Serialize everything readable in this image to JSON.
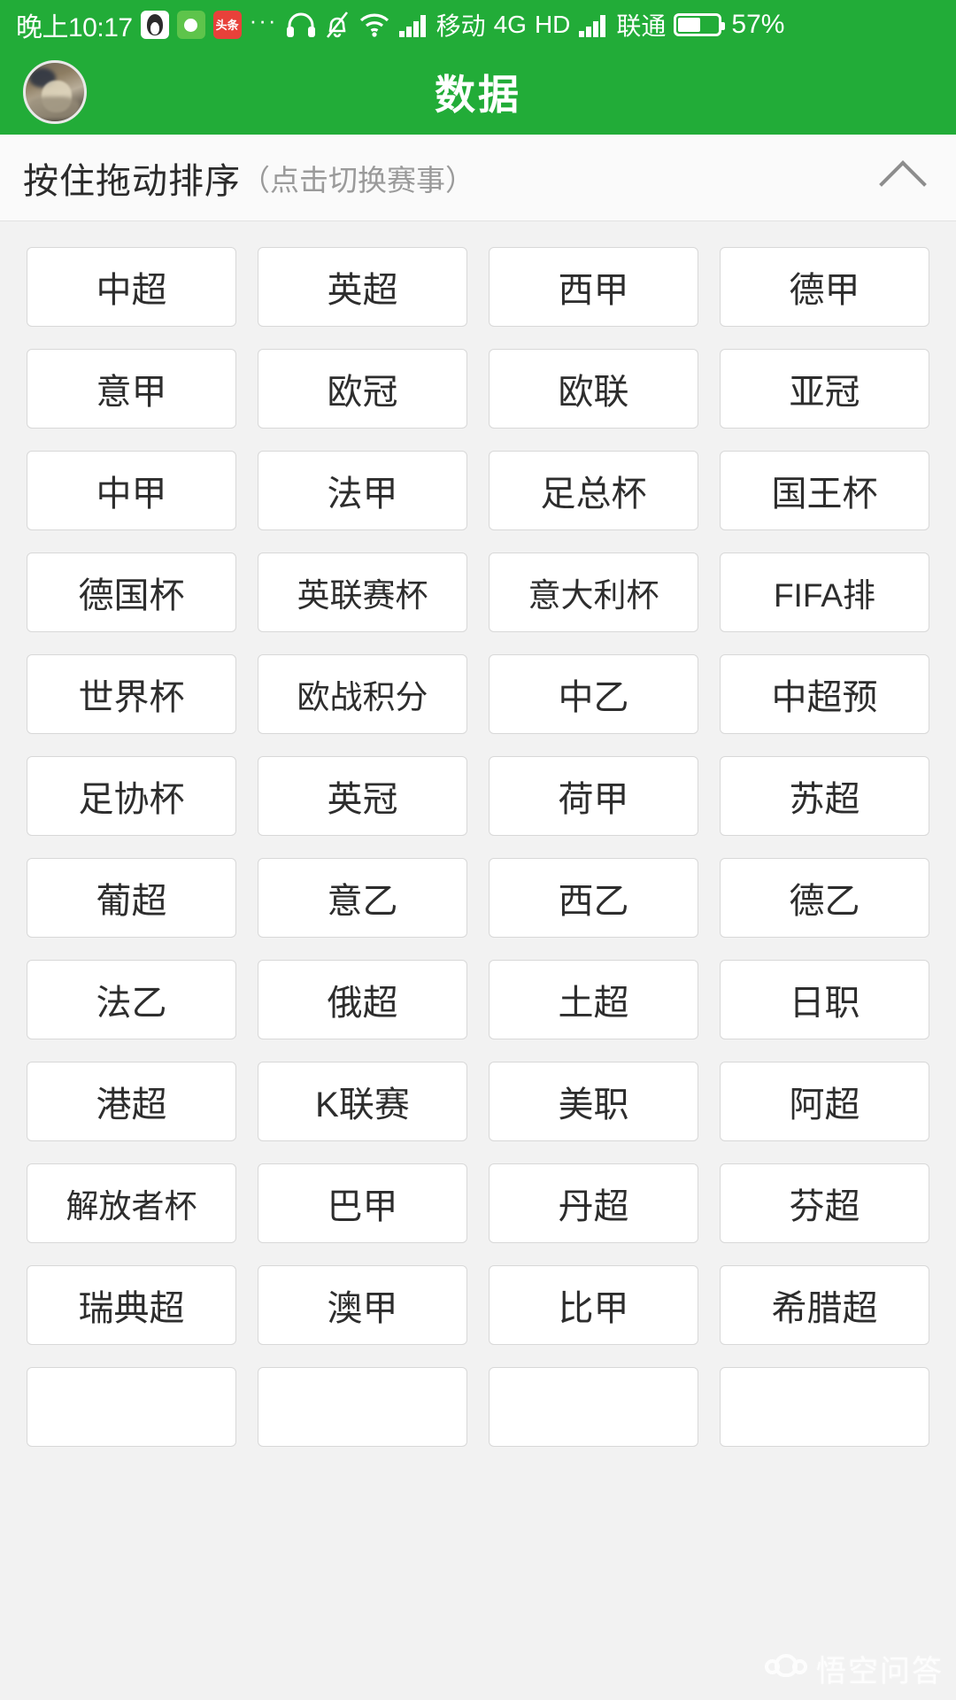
{
  "status_bar": {
    "time": "晚上10:17",
    "app_icons": [
      "qq-icon",
      "app-green-icon",
      "toutiao-icon"
    ],
    "more_label": "···",
    "icons": [
      "headphone-icon",
      "bell-muted-icon",
      "wifi-icon",
      "signal-icon"
    ],
    "carrier_1": "移动",
    "network_type": "4G",
    "hd_label": "HD",
    "carrier_2": "联通",
    "battery_percent": "57%",
    "battery_level": 57
  },
  "header": {
    "title": "数据",
    "avatar_name": "user-avatar"
  },
  "section": {
    "title": "按住拖动排序",
    "subtitle": "（点击切换赛事）",
    "collapse_icon": "chevron-up-icon"
  },
  "colors": {
    "brand_green": "#22ac38",
    "page_background": "#f2f2f2",
    "tile_background": "#ffffff",
    "tile_border": "#d8d8d8",
    "text_primary": "#2d2d2d",
    "text_muted": "#9a9a9a"
  },
  "leagues": [
    "中超",
    "英超",
    "西甲",
    "德甲",
    "意甲",
    "欧冠",
    "欧联",
    "亚冠",
    "中甲",
    "法甲",
    "足总杯",
    "国王杯",
    "德国杯",
    "英联赛杯",
    "意大利杯",
    "FIFA排",
    "世界杯",
    "欧战积分",
    "中乙",
    "中超预",
    "足协杯",
    "英冠",
    "荷甲",
    "苏超",
    "葡超",
    "意乙",
    "西乙",
    "德乙",
    "法乙",
    "俄超",
    "土超",
    "日职",
    "港超",
    "K联赛",
    "美职",
    "阿超",
    "解放者杯",
    "巴甲",
    "丹超",
    "芬超",
    "瑞典超",
    "澳甲",
    "比甲",
    "希腊超",
    "",
    "",
    "",
    ""
  ],
  "watermark": {
    "text": "悟空问答",
    "logo_name": "wukong-monkey-logo"
  }
}
